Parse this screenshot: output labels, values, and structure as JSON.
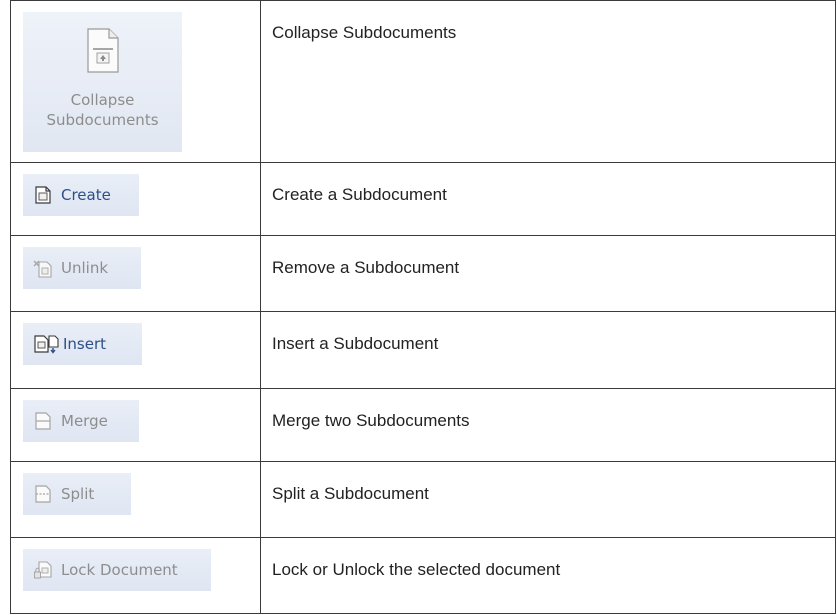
{
  "rows": [
    {
      "button_label_line1": "Collapse",
      "button_label_line2": "Subdocuments",
      "icon": "collapse-subdocuments-icon",
      "state": "disabled",
      "description": "Collapse Subdocuments"
    },
    {
      "button_label": "Create",
      "icon": "create-subdocument-icon",
      "state": "active",
      "description": "Create a Subdocument"
    },
    {
      "button_label": "Unlink",
      "icon": "unlink-subdocument-icon",
      "state": "disabled",
      "description": "Remove a Subdocument"
    },
    {
      "button_label": "Insert",
      "icon": "insert-subdocument-icon",
      "state": "active",
      "description": "Insert a Subdocument"
    },
    {
      "button_label": "Merge",
      "icon": "merge-subdocuments-icon",
      "state": "disabled",
      "description": "Merge two Subdocuments"
    },
    {
      "button_label": "Split",
      "icon": "split-subdocument-icon",
      "state": "disabled",
      "description": "Split a Subdocument"
    },
    {
      "button_label": "Lock Document",
      "icon": "lock-document-icon",
      "state": "disabled",
      "description": "Lock or Unlock the selected document"
    }
  ],
  "colors": {
    "active_text": "#2d4f86",
    "disabled_text": "#8d8d8d",
    "button_bg": "#e3e9f4",
    "border": "#3a3a3a"
  }
}
